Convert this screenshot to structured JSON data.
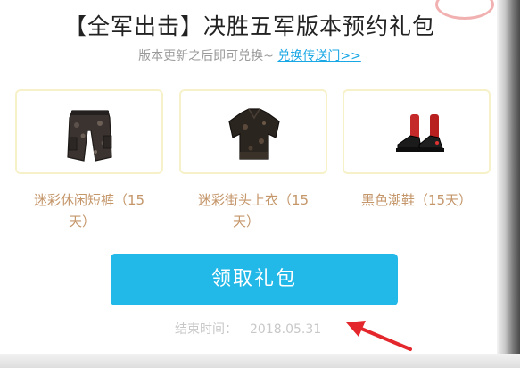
{
  "header": {
    "title": "【全军出击】决胜五军版本预约礼包",
    "subtitle_prefix": "版本更新之后即可兑换~",
    "subtitle_link": "兑换传送门>>"
  },
  "items": [
    {
      "label_line1": "迷彩休闲短裤（15",
      "label_line2": "天）",
      "icon": "camo-shorts-icon"
    },
    {
      "label_line1": "迷彩街头上衣（15",
      "label_line2": "天）",
      "icon": "camo-shirt-icon"
    },
    {
      "label_line1": "黑色潮鞋（15天）",
      "label_line2": "",
      "icon": "black-sneakers-icon"
    }
  ],
  "claim_button_label": "领取礼包",
  "end_time": {
    "label": "结束时间：",
    "value": "2018.05.31"
  },
  "colors": {
    "accent": "#22b8e8",
    "item_label": "#c4966a",
    "card_border": "#f7f1c9",
    "annotation_arrow": "#e4272c"
  }
}
